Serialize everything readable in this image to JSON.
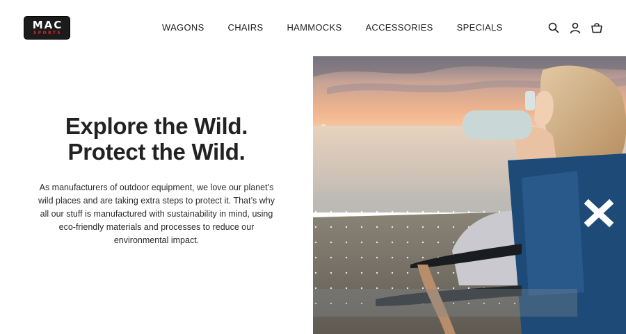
{
  "header": {
    "logo": {
      "mark": "MAC",
      "sub": "SPORTS"
    },
    "nav": [
      {
        "label": "WAGONS"
      },
      {
        "label": "CHAIRS"
      },
      {
        "label": "HAMMOCKS"
      },
      {
        "label": "ACCESSORIES"
      },
      {
        "label": "SPECIALS"
      }
    ],
    "icons": [
      "search-icon",
      "account-icon",
      "cart-icon"
    ]
  },
  "hero": {
    "headline_line1": "Explore the Wild.",
    "headline_line2": "Protect the Wild.",
    "body": "As manufacturers of outdoor equipment, we love our planet’s wild places and are taking extra steps to protect it. That’s why all our stuff is manufactured with sustainability in mind, using eco-friendly materials and processes to reduce our environmental impact."
  },
  "colors": {
    "text": "#1e1e1e",
    "logo_bg": "#1b1b1b",
    "logo_accent": "#e0242c",
    "chair_blue": "#1e4a78"
  }
}
